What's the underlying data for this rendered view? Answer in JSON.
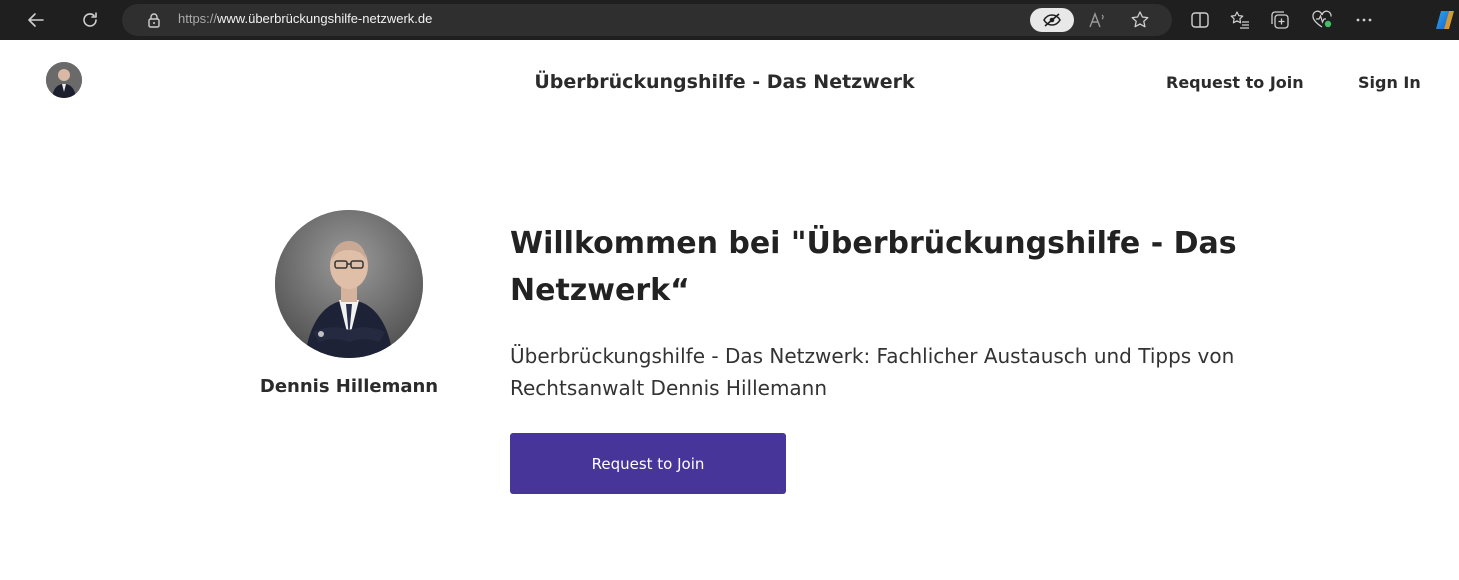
{
  "browser": {
    "url_scheme": "https://",
    "url_host": "www.überbrückungshilfe-netzwerk.de",
    "icons": [
      "back-arrow-icon",
      "refresh-icon",
      "lock-icon",
      "tracking-prevention-icon",
      "read-aloud-icon",
      "favorite-star-icon",
      "split-screen-icon",
      "favorites-list-icon",
      "collections-icon",
      "browser-essentials-icon",
      "more-icon",
      "copilot-icon"
    ],
    "chrome_color": "#1f1f1f"
  },
  "header": {
    "site_title": "Überbrückungshilfe - Das Netzwerk",
    "nav": {
      "request_label": "Request to Join",
      "signin_label": "Sign In"
    }
  },
  "hero": {
    "profile_name": "Dennis Hillemann",
    "title": "Willkommen bei \"Überbrückungshilfe - Das Netzwerk“",
    "subtitle": "Überbrückungshilfe - Das Netzwerk: Fachlicher Austausch und Tipps von Rechtsanwalt Dennis Hillemann",
    "cta_label": "Request to Join"
  },
  "colors": {
    "accent": "#48359a",
    "text": "#2b2b2b"
  }
}
